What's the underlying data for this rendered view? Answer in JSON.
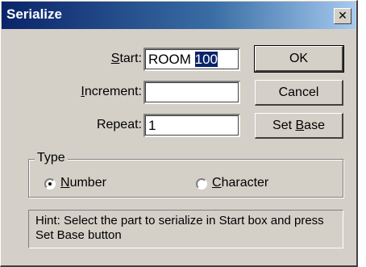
{
  "window": {
    "title": "Serialize",
    "close_glyph": "✕"
  },
  "fields": {
    "start": {
      "label_accel": "S",
      "label_rest": "tart:",
      "value_prefix": "ROOM ",
      "value_selected": "100"
    },
    "increment": {
      "label_accel": "I",
      "label_rest": "ncrement:",
      "value": ""
    },
    "repeat": {
      "label": "Repeat:",
      "value": "1"
    }
  },
  "buttons": {
    "ok": "OK",
    "cancel": "Cancel",
    "set_base_prefix": "Set ",
    "set_base_accel": "B",
    "set_base_rest": "ase"
  },
  "type_group": {
    "legend": "Type",
    "options": [
      {
        "accel": "N",
        "rest": "umber",
        "selected": true
      },
      {
        "accel": "C",
        "rest": "haracter",
        "selected": false
      }
    ]
  },
  "hint": "Hint: Select the part to serialize in Start box and press Set Base button"
}
